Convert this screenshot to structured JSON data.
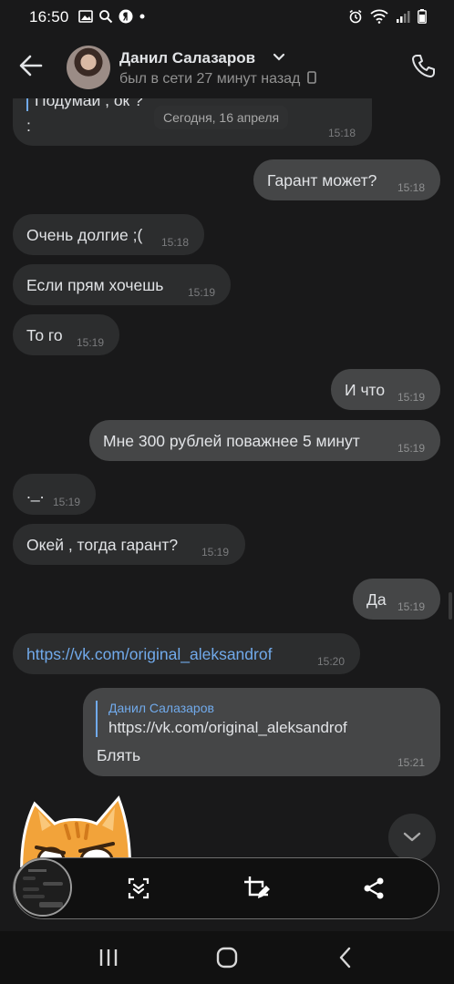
{
  "status": {
    "time": "16:50"
  },
  "header": {
    "contact_name": "Данил Салазаров",
    "presence": "был в сети 27 минут назад"
  },
  "date_separator": "Сегодня, 16 апреля",
  "messages": [
    {
      "dir": "in",
      "text": "Подумай , ок ?",
      "extra": ":",
      "time": "15:18"
    },
    {
      "dir": "out",
      "text": "Гарант может?",
      "time": "15:18"
    },
    {
      "dir": "in",
      "text": "Очень долгие ;(",
      "time": "15:18"
    },
    {
      "dir": "in",
      "text": "Если прям хочешь",
      "time": "15:19"
    },
    {
      "dir": "in",
      "text": "То го",
      "time": "15:19"
    },
    {
      "dir": "out",
      "text": "И что",
      "time": "15:19"
    },
    {
      "dir": "out",
      "text": "Мне 300 рублей поважнее 5 минут",
      "time": "15:19"
    },
    {
      "dir": "in",
      "text": "._.",
      "time": "15:19"
    },
    {
      "dir": "in",
      "text": "Окей , тогда гарант?",
      "time": "15:19"
    },
    {
      "dir": "out",
      "text": "Да",
      "time": "15:19"
    },
    {
      "dir": "in",
      "text": "https://vk.com/original_aleksandrof",
      "time": "15:20",
      "is_link": true
    },
    {
      "dir": "out",
      "reply_to": "Данил Салазаров",
      "reply_text": "https://vk.com/original_aleksandrof",
      "text": "Блять",
      "time": "15:21"
    }
  ],
  "icons": {
    "back": "arrow-left-icon",
    "chevron": "chevron-down-icon",
    "call": "phone-icon",
    "scroll": "chevron-down-icon",
    "toolbar": [
      "scroll-capture-icon",
      "crop-edit-icon",
      "share-icon"
    ],
    "nav": [
      "recents-icon",
      "home-icon",
      "back-icon"
    ]
  },
  "colors": {
    "accent": "#71aaeb",
    "bubble_in": "#2c2d2e",
    "bubble_out": "#454647",
    "background": "#19191a"
  }
}
